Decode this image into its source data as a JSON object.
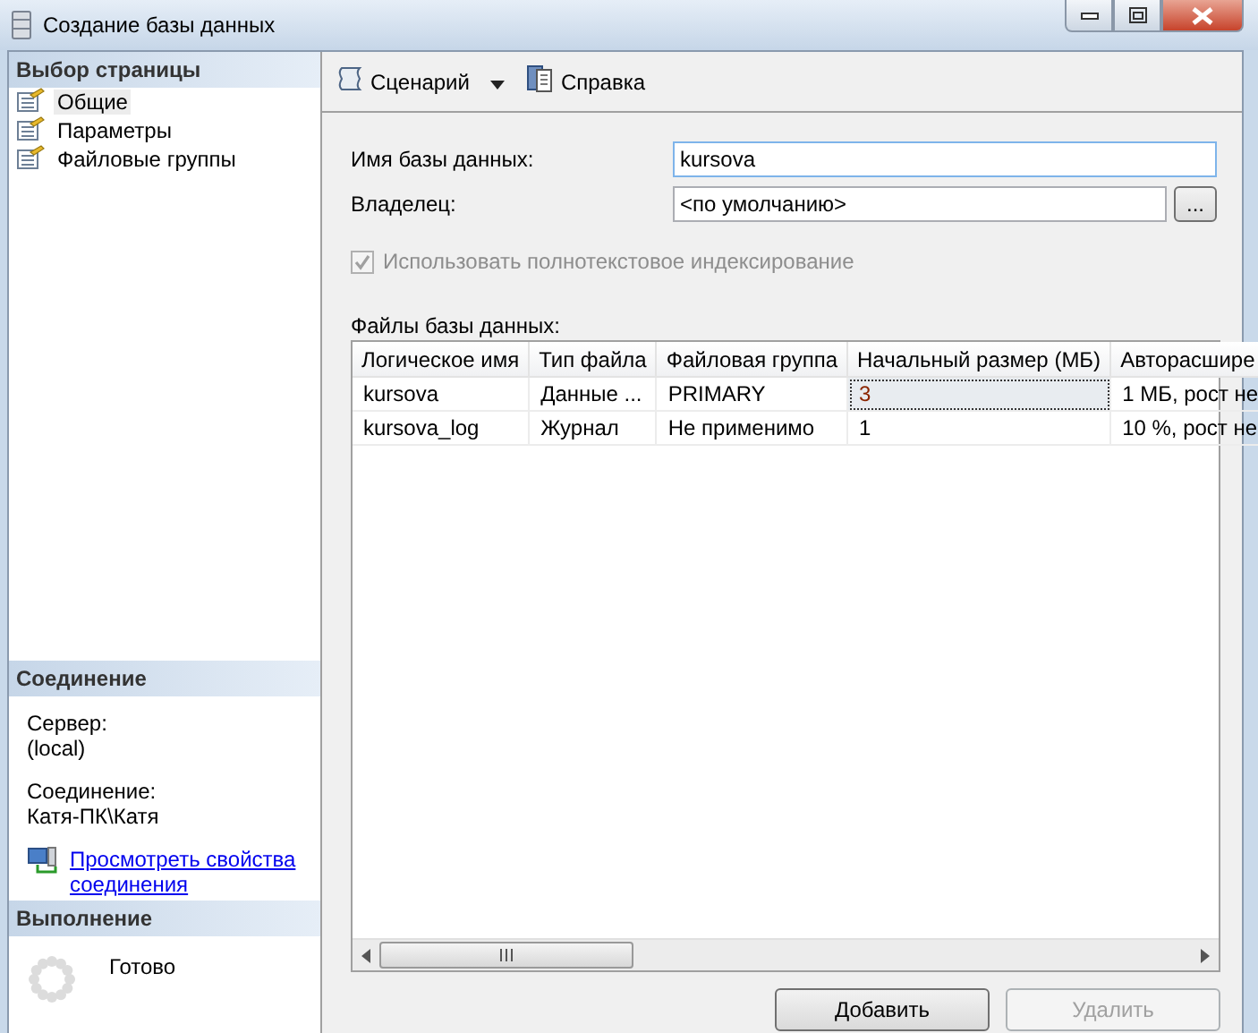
{
  "window": {
    "title": "Создание базы данных"
  },
  "sidebar": {
    "header": "Выбор страницы",
    "items": [
      {
        "label": "Общие",
        "selected": true
      },
      {
        "label": "Параметры",
        "selected": false
      },
      {
        "label": "Файловые группы",
        "selected": false
      }
    ]
  },
  "connection": {
    "header": "Соединение",
    "server_label": "Сервер:",
    "server": "(local)",
    "connection_label": "Соединение:",
    "connection": "Катя-ПК\\Катя",
    "link": "Просмотреть свойства соединения"
  },
  "progress": {
    "header": "Выполнение",
    "status": "Готово"
  },
  "toolbar": [
    {
      "label": "Сценарий",
      "kind": "script",
      "dropdown": true
    },
    {
      "label": "Справка",
      "kind": "help",
      "dropdown": false
    }
  ],
  "form": {
    "name_label": "Имя базы данных:",
    "name_value": "kursova",
    "owner_label": "Владелец:",
    "owner_value": "<по умолчанию>",
    "browse": "...",
    "fulltext": {
      "label": "Использовать полнотекстовое индексирование",
      "checked": true,
      "disabled": true
    }
  },
  "files": {
    "label": "Файлы базы данных:",
    "columns": [
      "Логическое имя",
      "Тип файла",
      "Файловая группа",
      "Начальный размер (МБ)",
      "Авторасшире"
    ],
    "rows": [
      {
        "cells": [
          "kursova",
          "Данные ...",
          "PRIMARY",
          "3",
          "1 МБ, рост не"
        ],
        "focused": true
      },
      {
        "cells": [
          "kursova_log",
          "Журнал",
          "Не применимо",
          "1",
          "10 %, рост не"
        ],
        "focused": false
      }
    ]
  },
  "buttons": [
    {
      "label": "Добавить",
      "disabled": false
    },
    {
      "label": "Удалить",
      "disabled": true
    }
  ]
}
